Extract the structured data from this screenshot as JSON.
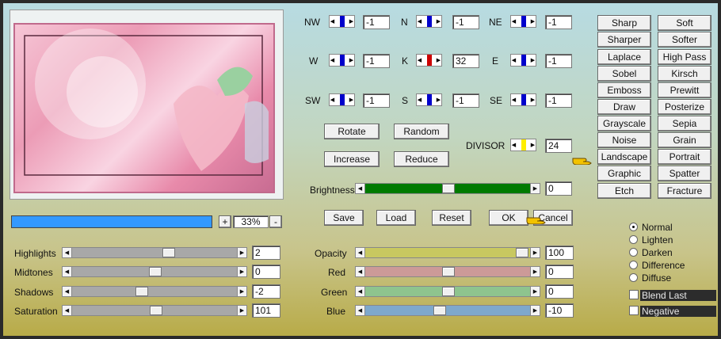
{
  "kernel": {
    "rows": [
      [
        {
          "label": "NW",
          "value": "-1"
        },
        {
          "label": "N",
          "value": "-1"
        },
        {
          "label": "NE",
          "value": "-1"
        }
      ],
      [
        {
          "label": "W",
          "value": "-1"
        },
        {
          "label": "K",
          "value": "32"
        },
        {
          "label": "E",
          "value": "-1"
        }
      ],
      [
        {
          "label": "SW",
          "value": "-1"
        },
        {
          "label": "S",
          "value": "-1"
        },
        {
          "label": "SE",
          "value": "-1"
        }
      ]
    ],
    "divisor_label": "DIVISOR",
    "divisor_value": "24"
  },
  "action_buttons": {
    "rotate": "Rotate",
    "random": "Random",
    "increase": "Increase",
    "reduce": "Reduce"
  },
  "brightness": {
    "label": "Brightness",
    "value": "0"
  },
  "file_buttons": {
    "save": "Save",
    "load": "Load",
    "reset": "Reset",
    "ok": "OK",
    "cancel": "Cancel"
  },
  "zoom": {
    "value": "33%",
    "plus": "+",
    "minus": "-"
  },
  "presets": [
    [
      "Sharp",
      "Soft"
    ],
    [
      "Sharper",
      "Softer"
    ],
    [
      "Laplace",
      "High Pass"
    ],
    [
      "Sobel",
      "Kirsch"
    ],
    [
      "Emboss",
      "Prewitt"
    ],
    [
      "Draw",
      "Posterize"
    ],
    [
      "Grayscale",
      "Sepia"
    ],
    [
      "Noise",
      "Grain"
    ],
    [
      "Landscape",
      "Portrait"
    ],
    [
      "Graphic",
      "Spatter"
    ],
    [
      "Etch",
      "Fracture"
    ]
  ],
  "tone": [
    {
      "label": "Highlights",
      "value": "2"
    },
    {
      "label": "Midtones",
      "value": "0"
    },
    {
      "label": "Shadows",
      "value": "-2"
    },
    {
      "label": "Saturation",
      "value": "101"
    }
  ],
  "color": [
    {
      "label": "Opacity",
      "value": "100",
      "color": "#c8c860"
    },
    {
      "label": "Red",
      "value": "0",
      "color": "#cc9a98"
    },
    {
      "label": "Green",
      "value": "0",
      "color": "#8ec48e"
    },
    {
      "label": "Blue",
      "value": "-10",
      "color": "#7ea8cc"
    }
  ],
  "blend_modes": [
    "Normal",
    "Lighten",
    "Darken",
    "Difference",
    "Diffuse"
  ],
  "selected_mode": "Normal",
  "checkboxes": {
    "blend_last": "Blend Last",
    "negative": "Negative"
  },
  "colors": {
    "brightness_track": "#007a00",
    "progress": "#3399ff",
    "kernel_marker": "#0000cc",
    "k_marker": "#cc0000",
    "divisor_marker": "#ffee00",
    "hand": "#f2c200"
  }
}
